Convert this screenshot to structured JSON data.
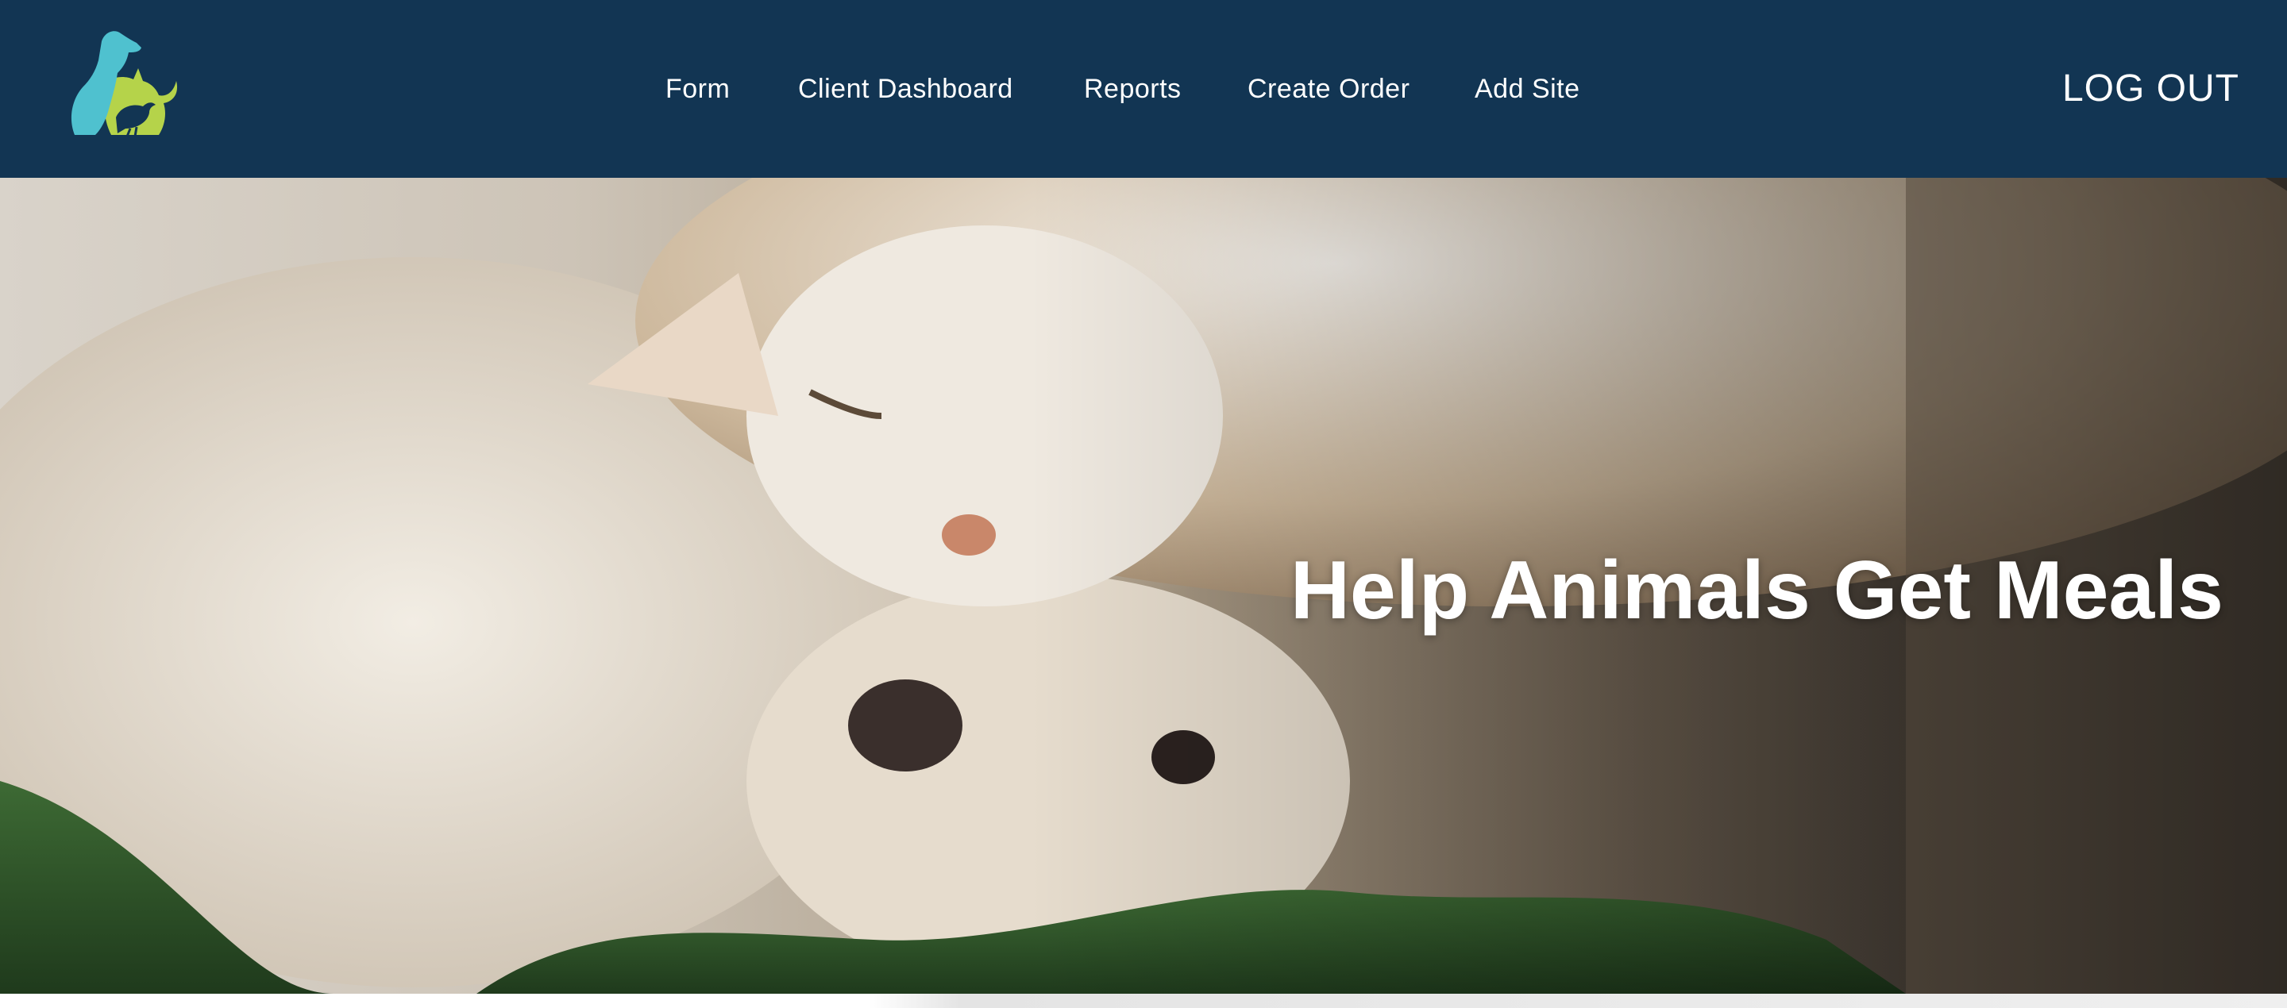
{
  "header": {
    "logo_icon": "pet-silhouettes-logo",
    "nav_items": [
      {
        "label": "Form"
      },
      {
        "label": "Client Dashboard"
      },
      {
        "label": "Reports"
      },
      {
        "label": "Create Order"
      },
      {
        "label": "Add Site"
      }
    ],
    "logout_label": "LOG OUT"
  },
  "hero": {
    "title": "Help Animals Get Meals",
    "image_icon": "cat-and-dog-photo"
  },
  "colors": {
    "navbar_bg": "#123553",
    "logo_blue": "#4fc1cf",
    "logo_green": "#b5d34a",
    "text_white": "#ffffff"
  }
}
